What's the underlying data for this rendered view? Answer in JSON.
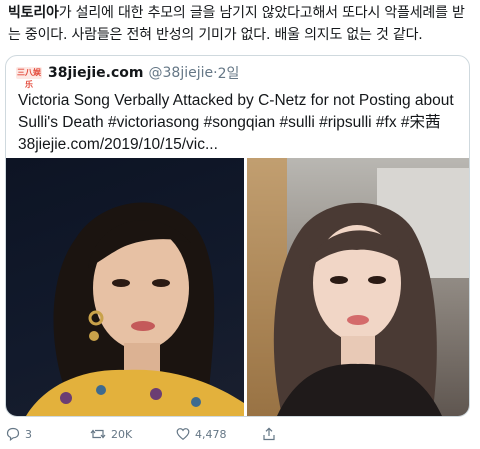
{
  "tweet": {
    "mention": "빅토리아",
    "text_rest": "가 설리에 대한 추모의 글을 남기지 않았다고해서 또다시 악플세례를 받는 중이다. 사람들은 전혀 반성의 기미가 없다. 배울 의지도 없는 것 같다."
  },
  "quote": {
    "logo_text": "三八娱乐",
    "account_name": "38jiejie.com",
    "handle": "@38jiejie",
    "separator": "·",
    "time": "2일",
    "body": "Victoria Song Verbally Attacked by C-Netz for not Posting about Sulli's Death #victoriasong #songqian #sulli #ripsulli #fx #宋茜 38jiejie.com/2019/10/15/vic..."
  },
  "actions": {
    "replies": "3",
    "retweets": "20K",
    "likes": "4,478"
  },
  "colors": {
    "text": "#14171a",
    "muted": "#657786",
    "border": "#cfd9de",
    "logo_red": "#e3493a"
  }
}
